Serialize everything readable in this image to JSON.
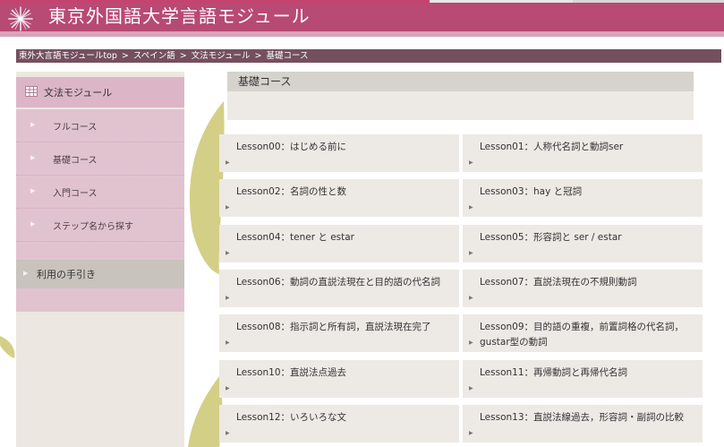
{
  "header": {
    "site_title": "東京外国語大学言語モジュール"
  },
  "breadcrumb": {
    "items": [
      "東外大言語モジュールtop",
      "スペイン語",
      "文法モジュール",
      "基礎コース"
    ],
    "separator": ">"
  },
  "sidebar": {
    "heading": "文法モジュール",
    "items": [
      {
        "label": "フルコース"
      },
      {
        "label": "基礎コース"
      },
      {
        "label": "入門コース"
      },
      {
        "label": "ステップ名から探す"
      }
    ],
    "guide_label": "利用の手引き"
  },
  "main": {
    "section_title": "基礎コース",
    "lessons": [
      "Lesson00：はじめる前に",
      "Lesson01：人称代名詞と動詞ser",
      "Lesson02：名詞の性と数",
      "Lesson03：hay と冠詞",
      "Lesson04：tener と estar",
      "Lesson05：形容詞と ser / estar",
      "Lesson06：動詞の直説法現在と目的語の代名詞",
      "Lesson07：直説法現在の不規則動詞",
      "Lesson08：指示詞と所有詞，直説法現在完了",
      "Lesson09：目的語の重複，前置詞格の代名詞，gustar型の動詞",
      "Lesson10：直説法点過去",
      "Lesson11：再帰動詞と再帰代名詞",
      "Lesson12：いろいろな文",
      "Lesson13：直説法線過去，形容詞・副詞の比較"
    ]
  },
  "colors": {
    "header": "#b64a72",
    "breadcrumb_bg": "#74505f",
    "sidebar_pink": "#e1c3d0",
    "panel_beige": "#ede9e5",
    "leaf": "#d4cf86"
  }
}
